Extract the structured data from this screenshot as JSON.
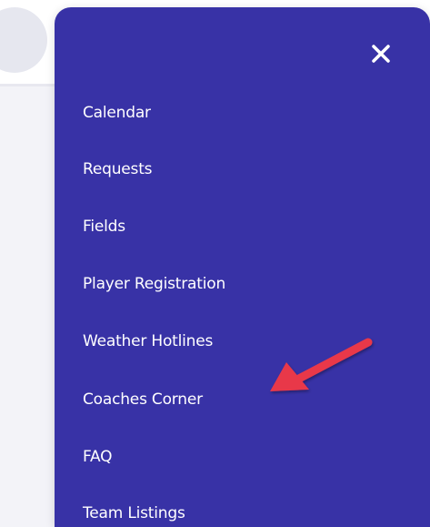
{
  "menu": {
    "close_icon": "close-icon",
    "items": [
      {
        "label": "Calendar"
      },
      {
        "label": "Requests"
      },
      {
        "label": "Fields"
      },
      {
        "label": "Player Registration"
      },
      {
        "label": "Weather Hotlines"
      },
      {
        "label": "Coaches Corner"
      },
      {
        "label": "FAQ"
      },
      {
        "label": "Team Listings"
      }
    ]
  },
  "annotation": {
    "arrow_icon": "arrow-icon",
    "arrow_color": "#e8394a"
  },
  "colors": {
    "menu_background": "#3832a6",
    "menu_text": "#ffffff",
    "page_background": "#f3f3f8"
  }
}
